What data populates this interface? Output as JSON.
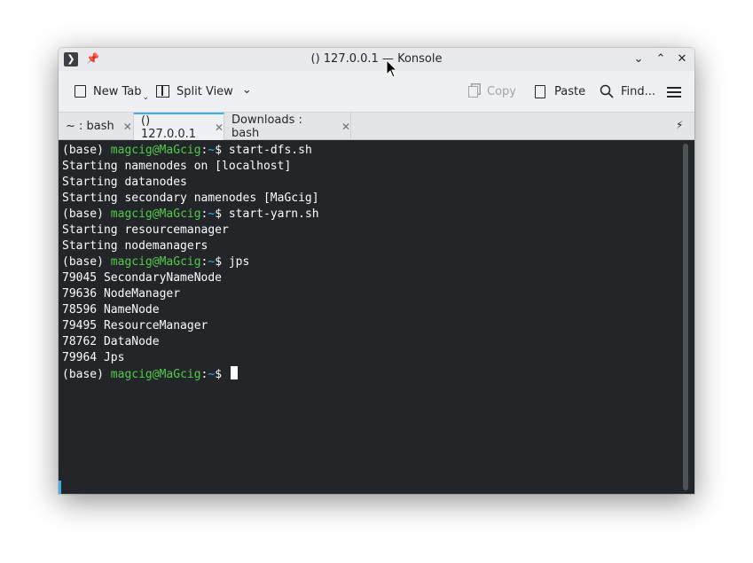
{
  "window": {
    "title": "() 127.0.0.1 — Konsole",
    "icons": {
      "app": "terminal-icon",
      "pin": "pin-icon",
      "minimize": "chevron-down-icon",
      "maximize": "chevron-up-icon",
      "close": "close-icon"
    },
    "glyphs": {
      "app": "❯",
      "pin": "📌",
      "minimize": "⌄",
      "maximize": "⌃",
      "close": "✕"
    }
  },
  "toolbar": {
    "new_tab_label": "New Tab",
    "split_view_label": "Split View",
    "copy_label": "Copy",
    "paste_label": "Paste",
    "find_label": "Find...",
    "dropdown_glyph": "⌄"
  },
  "tabs": [
    {
      "label": "~ : bash",
      "active": false
    },
    {
      "label": "() 127.0.0.1",
      "active": true
    },
    {
      "label": "Downloads : bash",
      "active": false
    }
  ],
  "tab_close_glyph": "✕",
  "tab_pin_glyph": "⚡",
  "terminal": {
    "prompt_env": "(base) ",
    "prompt_user": "magcig@MaGcig",
    "prompt_sep": ":",
    "prompt_path": "~",
    "prompt_end": "$ ",
    "lines": [
      {
        "type": "prompt",
        "command": "start-dfs.sh"
      },
      {
        "type": "output",
        "text": "Starting namenodes on [localhost]"
      },
      {
        "type": "output",
        "text": "Starting datanodes"
      },
      {
        "type": "output",
        "text": "Starting secondary namenodes [MaGcig]"
      },
      {
        "type": "prompt",
        "command": "start-yarn.sh"
      },
      {
        "type": "output",
        "text": "Starting resourcemanager"
      },
      {
        "type": "output",
        "text": "Starting nodemanagers"
      },
      {
        "type": "prompt",
        "command": "jps"
      },
      {
        "type": "output",
        "text": "79045 SecondaryNameNode"
      },
      {
        "type": "output",
        "text": "79636 NodeManager"
      },
      {
        "type": "output",
        "text": "78596 NameNode"
      },
      {
        "type": "output",
        "text": "79495 ResourceManager"
      },
      {
        "type": "output",
        "text": "78762 DataNode"
      },
      {
        "type": "output",
        "text": "79964 Jps"
      },
      {
        "type": "prompt",
        "command": "",
        "cursor": true
      }
    ]
  },
  "colors": {
    "terminal_bg": "#232629",
    "terminal_fg": "#fcfcfc",
    "prompt_user": "#54c94a",
    "prompt_path": "#3daee9",
    "accent": "#3daee9"
  }
}
